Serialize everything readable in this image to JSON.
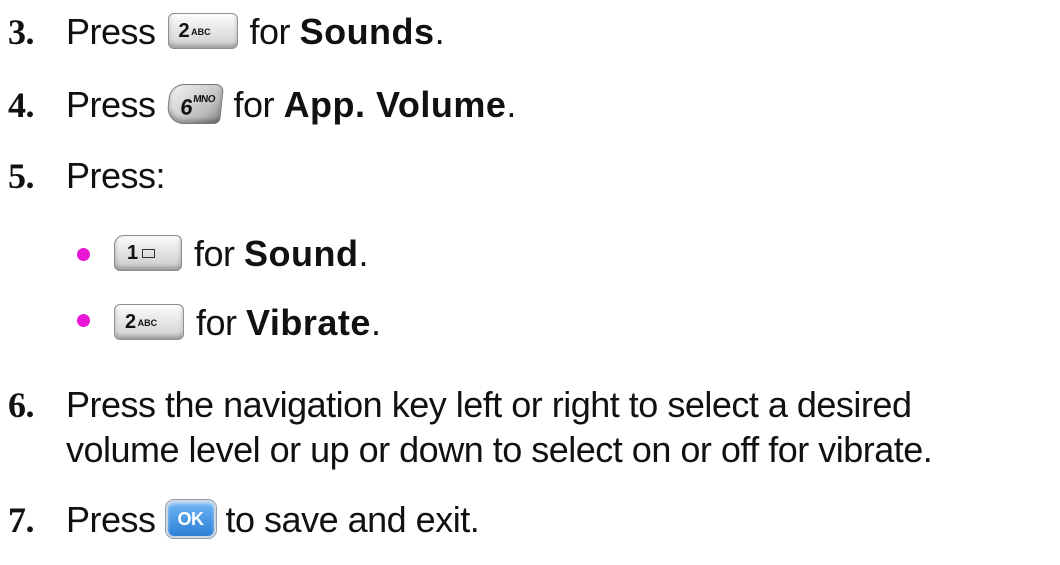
{
  "steps": [
    {
      "number": "3.",
      "pre": "Press",
      "key": {
        "main": "2",
        "sub": "ABC"
      },
      "mid": "for",
      "term": "Sounds",
      "post": "."
    },
    {
      "number": "4.",
      "pre": "Press",
      "key": {
        "main": "6",
        "sub": "MNO"
      },
      "mid": "for",
      "term": "App. Volume",
      "post": "."
    },
    {
      "number": "5.",
      "pre": "Press:",
      "bullets": [
        {
          "key": {
            "main": "1"
          },
          "mid": "for",
          "term": "Sound",
          "post": "."
        },
        {
          "key": {
            "main": "2",
            "sub": "ABC"
          },
          "mid": "for",
          "term": "Vibrate",
          "post": "."
        }
      ]
    },
    {
      "number": "6.",
      "line1": "Press the navigation key left or right to select a desired",
      "line2": "volume level or up or down to select on or off for vibrate."
    },
    {
      "number": "7.",
      "pre": "Press",
      "key": {
        "main": "OK"
      },
      "post": "to save and exit."
    }
  ],
  "colors": {
    "bullet": "#e817d6",
    "ok_key": "#2c7fd8"
  },
  "icons": {
    "key_2": "key-2-abc-icon",
    "key_6": "key-6-mno-icon",
    "key_1": "key-1-voicemail-icon",
    "key_ok": "ok-key-icon"
  }
}
